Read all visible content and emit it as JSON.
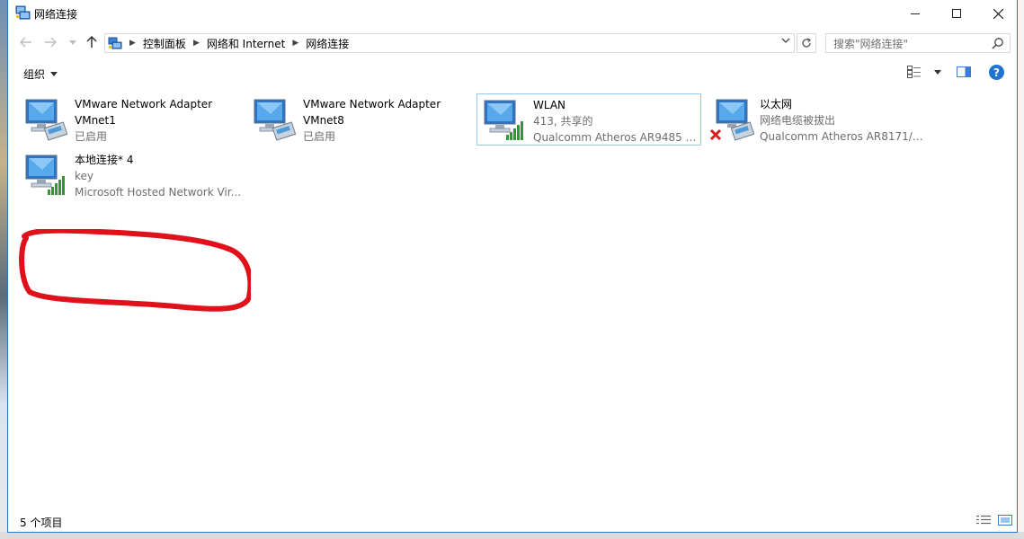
{
  "window": {
    "title": "网络连接",
    "colors": {
      "accent": "#2b78c9",
      "selected_border": "#99c9ef",
      "annotation": "#e0111b",
      "signal": "#2f9a2f"
    }
  },
  "nav": {
    "back_icon": "back-arrow-icon",
    "forward_icon": "forward-arrow-icon",
    "recent_icon": "chevron-down-icon",
    "up_icon": "up-arrow-icon"
  },
  "breadcrumb": [
    "控制面板",
    "网络和 Internet",
    "网络连接"
  ],
  "search": {
    "placeholder": "搜索\"网络连接\""
  },
  "toolbar": {
    "organize_label": "组织",
    "help_label": "?"
  },
  "connections": [
    {
      "name": "VMware Network Adapter",
      "line2": "VMnet1",
      "line3": "已启用",
      "status": "enabled",
      "icon": "network-adapter-icon"
    },
    {
      "name": "VMware Network Adapter",
      "line2": "VMnet8",
      "line3": "已启用",
      "status": "enabled",
      "icon": "network-adapter-icon"
    },
    {
      "name": "WLAN",
      "line2": "413, 共享的",
      "line3": "Qualcomm Atheros AR9485 W...",
      "status": "connected-wireless",
      "icon": "wireless-adapter-icon",
      "selected": true
    },
    {
      "name": "以太网",
      "line2": "网络电缆被拔出",
      "line3": "Qualcomm Atheros AR8171/8...",
      "status": "disconnected",
      "icon": "network-adapter-disconnected-icon"
    },
    {
      "name": "本地连接* 4",
      "line2": "key",
      "line3": "Microsoft Hosted Network Vir...",
      "status": "connected-wireless",
      "icon": "wireless-adapter-icon"
    }
  ],
  "statusbar": {
    "count_label": "5 个项目"
  }
}
